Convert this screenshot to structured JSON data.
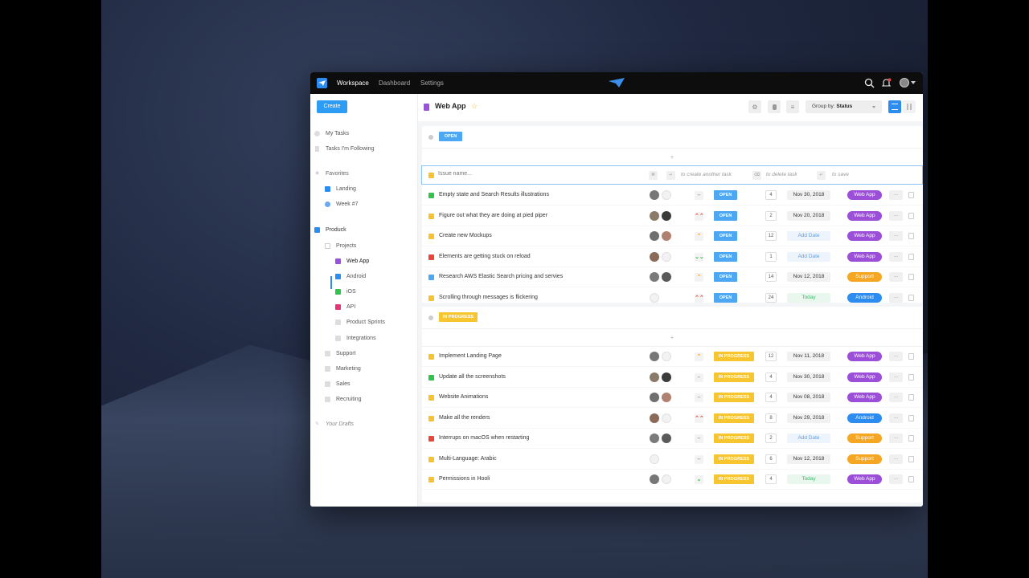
{
  "nav": {
    "items": [
      "Workspace",
      "Dashboard",
      "Settings"
    ]
  },
  "sidebar": {
    "create_label": "Create",
    "my_tasks": "My Tasks",
    "following": "Tasks I'm Following",
    "favorites": "Favorites",
    "fav_landing": "Landing",
    "fav_week": "Week #7",
    "product": "Produck",
    "projects": "Projects",
    "web_app": "Web App",
    "android": "Android",
    "ios": "iOS",
    "api": "API",
    "product_sprints": "Product Sprints",
    "integrations": "Integrations",
    "support": "Support",
    "marketing": "Marketing",
    "sales": "Sales",
    "recruiting": "Recruiting",
    "drafts": "Your Drafts"
  },
  "header": {
    "title": "Web App",
    "group_by_prefix": "Group by:",
    "group_by_value": "Status"
  },
  "colors": {
    "open": "#4ea7f2",
    "in_progress": "#f6c52f",
    "web_app_tag": "#9b4fd8",
    "support_tag": "#f5a623",
    "android_tag": "#2d8cf0"
  },
  "open_group": {
    "label": "OPEN",
    "new_issue_placeholder": "Issue name...",
    "hint_create": "to create another task",
    "hint_delete": "to delete task",
    "hint_save": "to save",
    "rows": [
      {
        "name": "Empty state and Search Results illustrations",
        "priority": "–",
        "status": "OPEN",
        "count": "4",
        "date": "Nov 30, 2018",
        "tag": "Web App"
      },
      {
        "name": "Figure out what they are doing at pied piper",
        "priority": "⌃⌃",
        "status": "OPEN",
        "count": "2",
        "date": "Nov 20, 2018",
        "tag": "Web App"
      },
      {
        "name": "Create new Mockups",
        "priority": "⌃",
        "status": "OPEN",
        "count": "12",
        "date": "Add Date",
        "tag": "Web App"
      },
      {
        "name": "Elements are getting stuck on reload",
        "priority": "⌄⌄",
        "status": "OPEN",
        "count": "1",
        "date": "Add Date",
        "tag": "Web App"
      },
      {
        "name": "Research AWS Elastic Search pricing and servies",
        "priority": "⌃",
        "status": "OPEN",
        "count": "14",
        "date": "Nov 12, 2018",
        "tag": "Support"
      },
      {
        "name": "Scrolling through messages is flickering",
        "priority": "⌃⌃",
        "status": "OPEN",
        "count": "24",
        "date": "Today",
        "tag": "Android"
      }
    ]
  },
  "ip_group": {
    "label": "IN PROGRESS",
    "rows": [
      {
        "name": "Implement Landing Page",
        "priority": "⌃",
        "status": "IN PROGRESS",
        "count": "12",
        "date": "Nov 11, 2018",
        "tag": "Web App"
      },
      {
        "name": "Update all the screenshots",
        "priority": "–",
        "status": "IN PROGRESS",
        "count": "4",
        "date": "Nov 30, 2018",
        "tag": "Web App"
      },
      {
        "name": "Website Animations",
        "priority": "–",
        "status": "IN PROGRESS",
        "count": "4",
        "date": "Nov 08, 2018",
        "tag": "Web App"
      },
      {
        "name": "Make all the renders",
        "priority": "⌃⌃",
        "status": "IN PROGRESS",
        "count": "8",
        "date": "Nov 29, 2018",
        "tag": "Android"
      },
      {
        "name": "Interrups on macOS when restarting",
        "priority": "–",
        "status": "IN PROGRESS",
        "count": "2",
        "date": "Add Date",
        "tag": "Support"
      },
      {
        "name": "Multi-Language: Arabic",
        "priority": "–",
        "status": "IN PROGRESS",
        "count": "6",
        "date": "Nov 12, 2018",
        "tag": "Support"
      },
      {
        "name": "Permissions in Hooli",
        "priority": "⌄",
        "status": "IN PROGRESS",
        "count": "4",
        "date": "Today",
        "tag": "Web App"
      }
    ]
  }
}
